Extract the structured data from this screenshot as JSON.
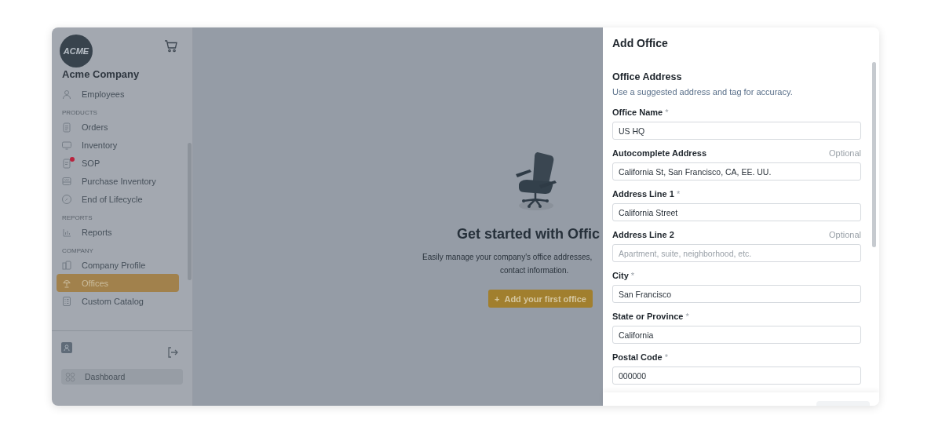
{
  "sidebar": {
    "logo": "ACME",
    "company": "Acme Company",
    "sections": [
      {
        "items": [
          {
            "label": "Employees",
            "selected": false,
            "notification": false
          }
        ]
      },
      {
        "heading": "PRODUCTS",
        "items": [
          {
            "label": "Orders",
            "selected": false,
            "notification": false
          },
          {
            "label": "Inventory",
            "selected": false,
            "notification": false
          },
          {
            "label": "SOP",
            "selected": false,
            "notification": true
          },
          {
            "label": "Purchase Inventory",
            "selected": false,
            "notification": false
          },
          {
            "label": "End of Lifecycle",
            "selected": false,
            "notification": false
          }
        ]
      },
      {
        "heading": "REPORTS",
        "items": [
          {
            "label": "Reports",
            "selected": false,
            "notification": false
          }
        ]
      },
      {
        "heading": "COMPANY",
        "items": [
          {
            "label": "Company Profile",
            "selected": false,
            "notification": false
          },
          {
            "label": "Offices",
            "selected": true,
            "notification": false
          },
          {
            "label": "Custom Catalog",
            "selected": false,
            "notification": false
          }
        ]
      }
    ],
    "dashboard": "Dashboard"
  },
  "empty_state": {
    "title": "Get started with Offic",
    "description_lines": [
      "Easily manage your company's office addresses,",
      "contact information."
    ],
    "button": {
      "icon": "+",
      "label": "Add your first office"
    }
  },
  "drawer": {
    "title": "Add Office",
    "section_title": "Office Address",
    "section_subtitle": "Use a suggested address and tag for accuracy.",
    "fields": [
      {
        "label": "Office Name",
        "required_mark": "*",
        "value": "US HQ"
      },
      {
        "label": "Autocomplete Address",
        "hint": "Optional",
        "value": "California St, San Francisco, CA, EE. UU."
      },
      {
        "label": "Address Line 1",
        "required_mark": "*",
        "value": "California Street"
      },
      {
        "label": "Address Line 2",
        "hint": "Optional",
        "placeholder": "Apartment, suite, neighborhood, etc."
      },
      {
        "label": "City",
        "required_mark": "*",
        "value": "San Francisco"
      },
      {
        "label": "State or Province",
        "required_mark": "*",
        "value": "California"
      },
      {
        "label": "Postal Code",
        "required_mark": "*",
        "value": "000000"
      }
    ]
  }
}
